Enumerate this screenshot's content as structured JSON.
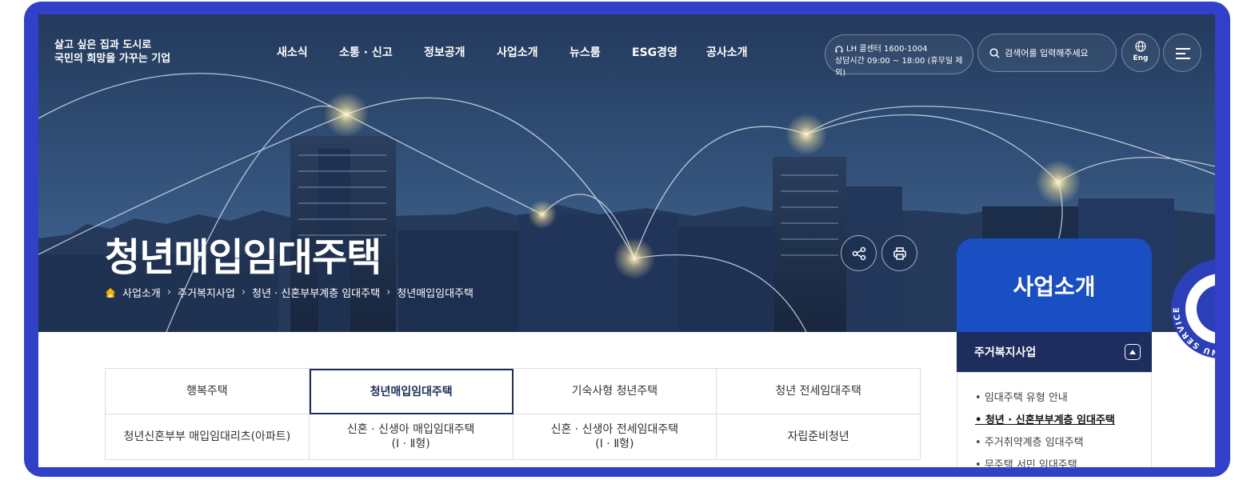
{
  "logo": {
    "line1": "살고 싶은 집과 도시로",
    "line2": "국민의 희망을 가꾸는 기업"
  },
  "gnb": [
    "새소식",
    "소통 · 신고",
    "정보공개",
    "사업소개",
    "뉴스룸",
    "ESG경영",
    "공사소개"
  ],
  "callcenter": {
    "line1": "LH 콜센터 1600-1004",
    "line2": "상담시간 09:00 ~ 18:00 (휴무일 제외)"
  },
  "search": {
    "placeholder": "검색어를 입력해주세요"
  },
  "language": {
    "label": "Eng"
  },
  "page": {
    "title": "청년매입임대주택"
  },
  "breadcrumb": [
    "사업소개",
    "주거복지사업",
    "청년 · 신혼부부계층 임대주택",
    "청년매입임대주택"
  ],
  "side": {
    "title": "사업소개",
    "section": "주거복지사업",
    "items": [
      "임대주택 유형 안내",
      "청년 · 신혼부부계층 임대주택",
      "주거취약계층 임대주택",
      "무주택 서민 임대주택"
    ],
    "active_index": 1
  },
  "quick_menu": {
    "label": "QUICK MENU SERVICE"
  },
  "tabs": [
    [
      "행복주택",
      "청년매입임대주택",
      "기숙사형 청년주택",
      "청년 전세임대주택"
    ],
    [
      "청년신혼부부 매입임대리츠(아파트)",
      "신혼 · 신생아 매입임대주택\n(Ⅰ · Ⅱ형)",
      "신혼 · 신생아 전세임대주택\n(Ⅰ · Ⅱ형)",
      "자립준비청년"
    ]
  ],
  "active_tab": "청년매입임대주택",
  "colors": {
    "frame": "#3040c8",
    "navy": "#1d2e5e",
    "blue": "#1a4fc4"
  }
}
